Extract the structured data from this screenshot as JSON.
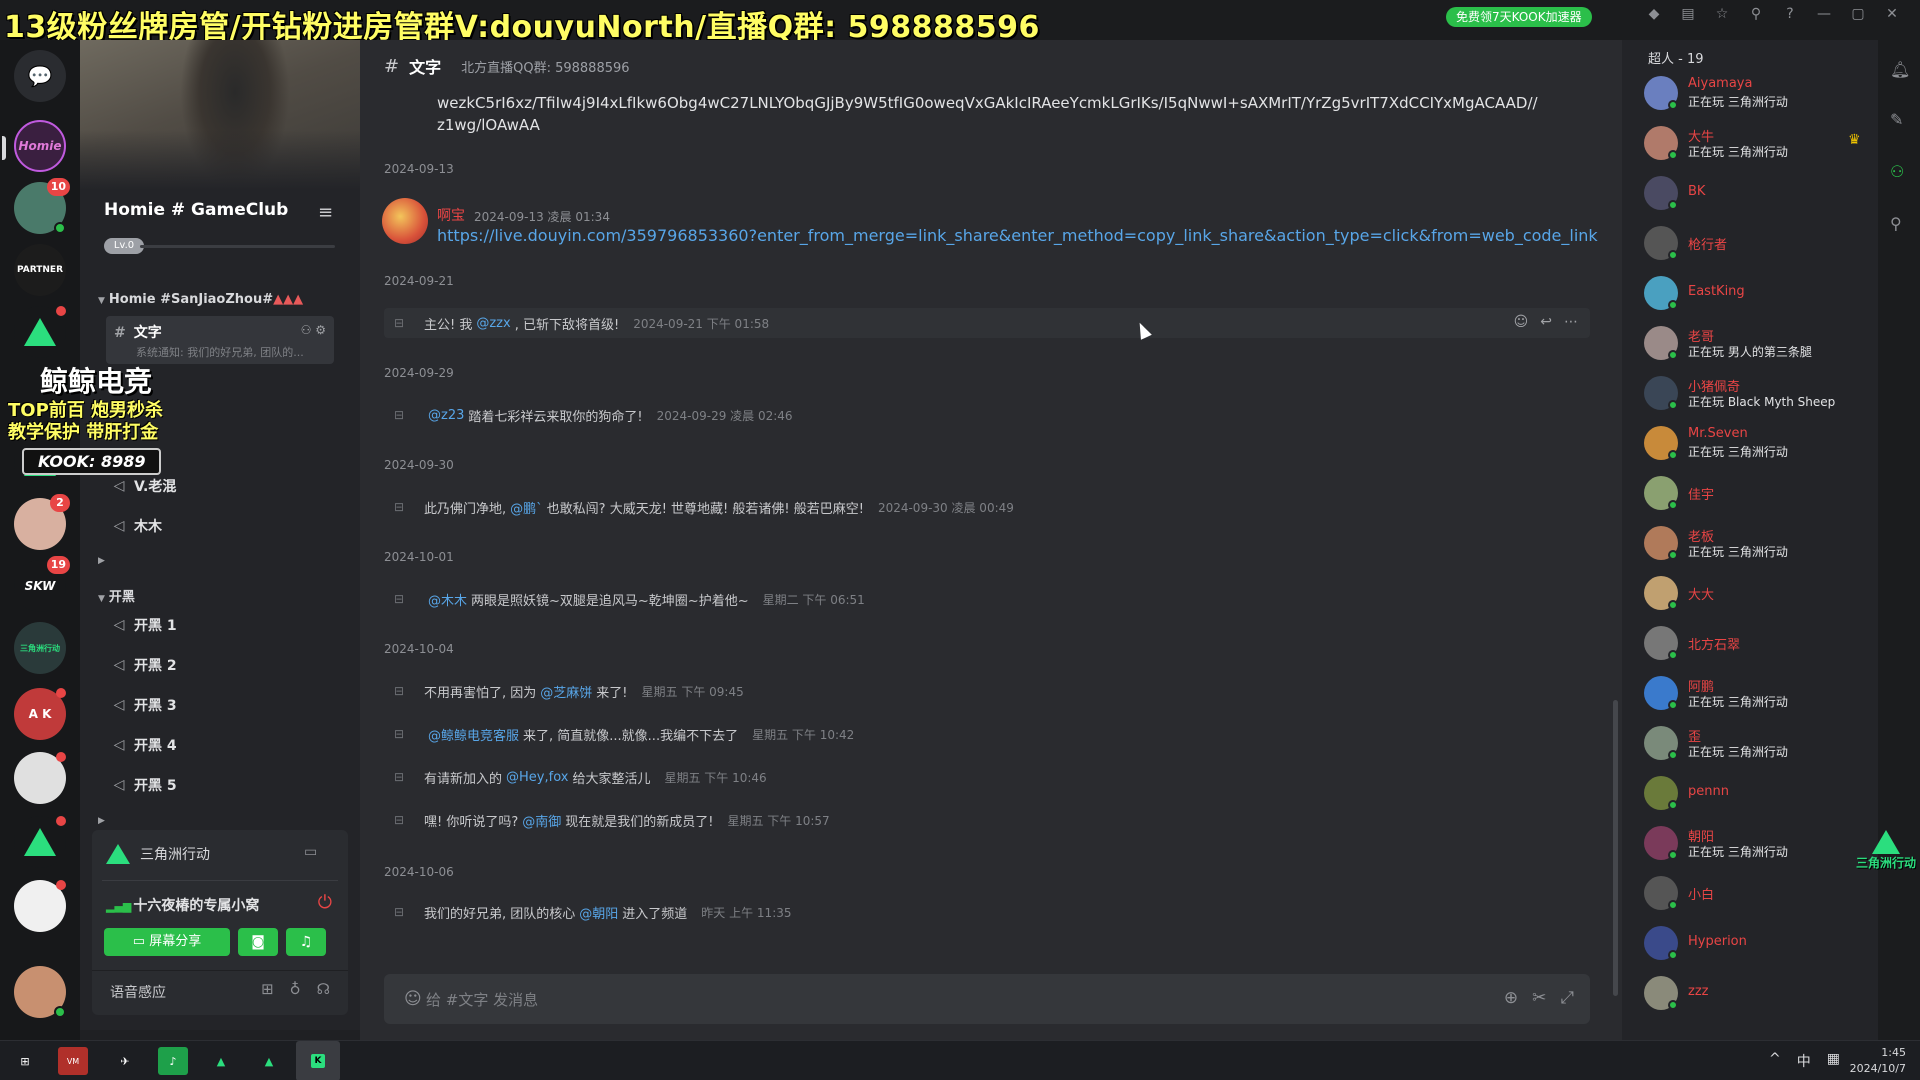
{
  "overlay": {
    "title": "13级粉丝牌房管/开钻粉进房管群V:douyuNorth/直播Q群: 598888596",
    "promo": "免费领7天KOOK加速器",
    "kook_ad": {
      "line1": "鲸鲸电竞",
      "line2": "TOP前百 炮男秒杀",
      "line3": "教学保护 带肝打金",
      "line4": "KOOK: 8989"
    },
    "right_logo": "三角洲行动"
  },
  "rail": {
    "badges": [
      "10",
      "2",
      "19"
    ],
    "labels": [
      "Homie",
      "三角洲行动",
      "SKW",
      "PARTNER",
      "A K"
    ]
  },
  "server": {
    "name": "Homie # GameClub",
    "level": "Lv.0",
    "category1": "Homie #SanJiaoZhou#",
    "category1_marks": "▲▲▲",
    "active_channel": {
      "name": "文字",
      "preview": "系统通知: 我们的好兄弟, 团队的..."
    },
    "voice_channels_1": [
      "V.老混",
      "木木"
    ],
    "category2": "开黑",
    "voice_channels_2": [
      "开黑 1",
      "开黑 2",
      "开黑 3",
      "开黑 4",
      "开黑 5"
    ]
  },
  "voice": {
    "game": "三角洲行动",
    "room": "十六夜椿的专属小窝",
    "share_label": "屏幕分享",
    "sense_label": "语音感应"
  },
  "chat": {
    "channel_title": "文字",
    "topic": "北方直播QQ群: 598888596",
    "trunc_text": "wezkC5rI6xz/TfiIw4j9I4xLfIkw6Obg4wC27LNLYObqGJjBy9W5tfIG0oweqVxGAkIcIRAeeYcmkLGrIKs/I5qNwwI+sAXMrIT/YrZg5vrIT7XdCCIYxMgACAAD// z1wg/lOAwAA",
    "dates": [
      "2024-09-13",
      "2024-09-21",
      "2024-09-29",
      "2024-09-30",
      "2024-10-01",
      "2024-10-04",
      "2024-10-06"
    ],
    "user_msg": {
      "name": "啊宝",
      "time": "2024-09-13 凌晨 01:34",
      "link": "https://live.douyin.com/359796853360?enter_from_merge=link_share&enter_method=copy_link_share&action_type=click&from=web_code_link"
    },
    "system_msgs": [
      {
        "pre": "主公! 我",
        "mention": "@zzx",
        "post": ", 已斩下敌将首级!",
        "time": "2024-09-21 下午 01:58"
      },
      {
        "pre": "",
        "mention": "@z23",
        "post": "踏着七彩祥云来取你的狗命了!",
        "time": "2024-09-29 凌晨 02:46"
      },
      {
        "pre": "此乃佛门净地,",
        "mention": "@鹏`",
        "post": "也敢私闯? 大威天龙! 世尊地藏! 般若诸佛! 般若巴麻空!",
        "time": "2024-09-30 凌晨 00:49"
      },
      {
        "pre": "",
        "mention": "@木木",
        "post": "两眼是照妖镜~双腿是追风马~乾坤圈~护着他~",
        "time": "星期二 下午 06:51"
      },
      {
        "pre": "不用再害怕了, 因为",
        "mention": "@芝麻饼",
        "post": "来了!",
        "time": "星期五 下午 09:45"
      },
      {
        "pre": "",
        "mention": "@鲸鲸电竞客服",
        "post": "来了, 简直就像...就像...我编不下去了",
        "time": "星期五 下午 10:42"
      },
      {
        "pre": "有请新加入的",
        "mention": "@Hey,fox",
        "post": "给大家整活儿",
        "time": "星期五 下午 10:46"
      },
      {
        "pre": "嘿! 你听说了吗?",
        "mention": "@南御",
        "post": "现在就是我们的新成员了!",
        "time": "星期五 下午 10:57"
      },
      {
        "pre": "我们的好兄弟, 团队的核心",
        "mention": "@朝阳",
        "post": "进入了频道",
        "time": "昨天 上午 11:35"
      }
    ],
    "composer_placeholder": "给 #文字 发消息"
  },
  "members": {
    "header": "超人 - 19",
    "list": [
      {
        "name": "Aiyamaya",
        "status": "正在玩 三角洲行动",
        "color": "#6a7fbf"
      },
      {
        "name": "大牛",
        "status": "正在玩 三角洲行动",
        "color": "#b07a6a"
      },
      {
        "name": "BK",
        "status": "",
        "color": "#4a4a62"
      },
      {
        "name": "枪行者",
        "status": "",
        "color": "#555"
      },
      {
        "name": "EastKing",
        "status": "",
        "color": "#4aa0c0"
      },
      {
        "name": "老哥",
        "status": "正在玩 男人的第三条腿",
        "color": "#9a8a88"
      },
      {
        "name": "小猪佩奇",
        "status": "正在玩 Black Myth Sheep",
        "color": "#3a4656"
      },
      {
        "name": "Mr.Seven",
        "status": "正在玩 三角洲行动",
        "color": "#c88a3a"
      },
      {
        "name": "佳宇",
        "status": "",
        "color": "#8aa070"
      },
      {
        "name": "老板",
        "status": "正在玩 三角洲行动",
        "color": "#b07a5a"
      },
      {
        "name": "大大",
        "status": "",
        "color": "#c0a070"
      },
      {
        "name": "北方石翠",
        "status": "",
        "color": "#777"
      },
      {
        "name": "阿鹏",
        "status": "正在玩 三角洲行动",
        "color": "#3a7acc"
      },
      {
        "name": "歪",
        "status": "正在玩 三角洲行动",
        "color": "#7a8a7a"
      },
      {
        "name": "pennn",
        "status": "",
        "color": "#6a7a3a"
      },
      {
        "name": "朝阳",
        "status": "正在玩 三角洲行动",
        "color": "#7a3a5a"
      },
      {
        "name": "小白",
        "status": "",
        "color": "#555"
      },
      {
        "name": "Hyperion",
        "status": "",
        "color": "#3a4a8a"
      },
      {
        "name": "zzz",
        "status": "",
        "color": "#8a8a7a"
      }
    ]
  },
  "taskbar": {
    "time": "1:45",
    "date": "2024/10/7",
    "ime": "中"
  }
}
